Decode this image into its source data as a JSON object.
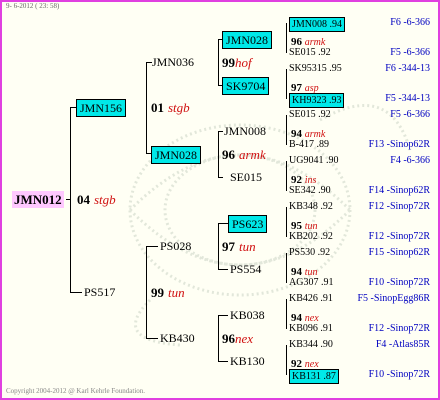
{
  "header": {
    "date_text": "9- 6-2012 ( 23: 58)"
  },
  "footer": {
    "copyright": "Copyright 2004-2012 @ Karl Kehrle Foundation."
  },
  "root": {
    "name": "JMN012"
  },
  "gen1": [
    {
      "name": "JMN156",
      "num": "04",
      "note": "stgb"
    },
    {
      "name": "PS517",
      "num": "99",
      "note": "tun"
    }
  ],
  "gen2": [
    {
      "name": "JMN036",
      "num": "01",
      "note": "stgb"
    },
    {
      "name": "JMN028",
      "num": "96",
      "note": "armk"
    },
    {
      "name": "PS028",
      "num": "97",
      "note": "tun"
    },
    {
      "name": "KB430",
      "num": "96",
      "note": "nex"
    }
  ],
  "gen3": [
    {
      "name": "JMN028",
      "num": "99",
      "note": "hof"
    },
    {
      "name": "SK9704"
    },
    {
      "name": "JMN008",
      "num": "96",
      "note": "armk"
    },
    {
      "name": "SE015"
    },
    {
      "name": "PS623",
      "num": "97",
      "note": "tun"
    },
    {
      "name": "PS554"
    },
    {
      "name": "KB038",
      "num": "96",
      "note": "nex"
    },
    {
      "name": "KB130"
    }
  ],
  "gen4": [
    {
      "name": "JMN008 .94",
      "right": "F6 -6-366",
      "num": "96",
      "note": "armk"
    },
    {
      "name": "SE015 .92",
      "right": "F5 -6-366"
    },
    {
      "name": "SK95315 .95",
      "right": "F6 -344-13",
      "num": "97",
      "note": "asp"
    },
    {
      "name": "KH9323 .93",
      "right": "F5 -344-13"
    },
    {
      "name": "SE015 .92",
      "right": "F5 -6-366",
      "num": "94",
      "note": "armk"
    },
    {
      "name": "B-417 .89",
      "right": "F13 -Sinop62R"
    },
    {
      "name": "UG9041 .90",
      "right": "F4 -6-366",
      "num": "92",
      "note": "ins"
    },
    {
      "name": "SE342 .90",
      "right": "F14 -Sinop62R"
    },
    {
      "name": "KB348 .92",
      "right": "F12 -Sinop72R",
      "num": "95",
      "note": "tun"
    },
    {
      "name": "KB202 .92",
      "right": "F12 -Sinop72R"
    },
    {
      "name": "PS530 .92",
      "right": "F15 -Sinop62R",
      "num": "94",
      "note": "tun"
    },
    {
      "name": "AG307 .91",
      "right": "F10 -Sinop72R"
    },
    {
      "name": "KB426 .91",
      "right": "F5 -SinopEgg86R",
      "num": "94",
      "note": "nex"
    },
    {
      "name": "KB096 .91",
      "right": "F12 -Sinop72R"
    },
    {
      "name": "KB344 .90",
      "right": "F4 -Atlas85R",
      "num": "92",
      "note": "nex"
    },
    {
      "name": "KB131 .87",
      "right": "F10 -Sinop72R"
    }
  ]
}
